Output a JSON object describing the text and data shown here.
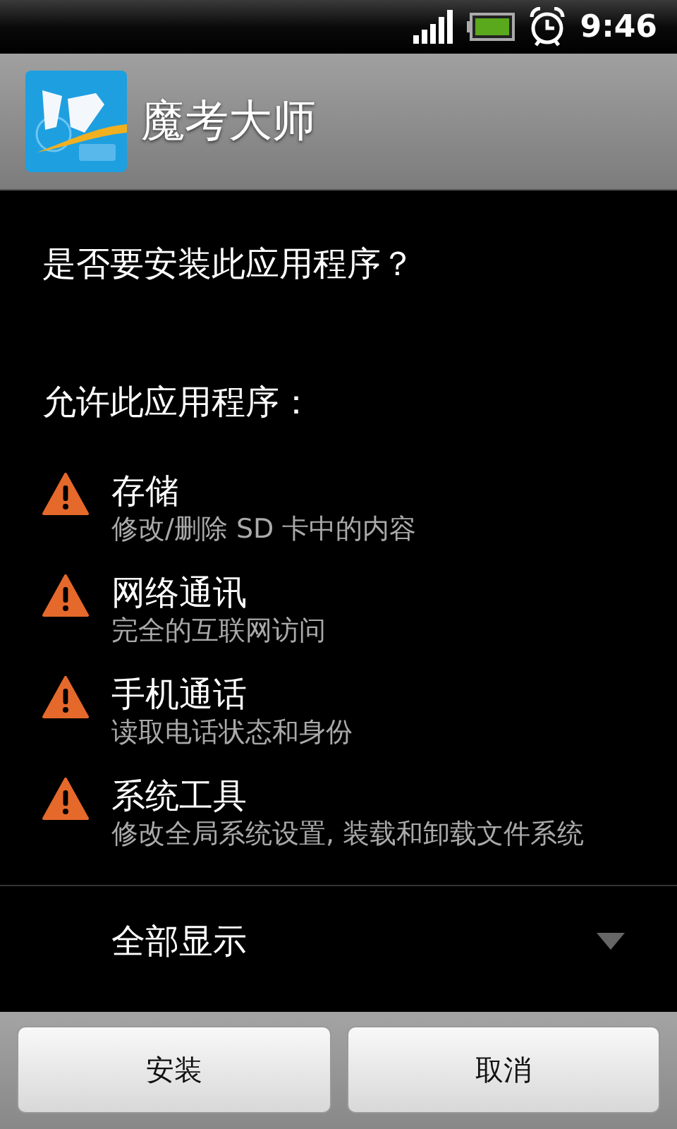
{
  "status_bar": {
    "time": "9:46"
  },
  "header": {
    "title": "魔考大师"
  },
  "question": "是否要安装此应用程序？",
  "permissions_heading": "允许此应用程序：",
  "permissions": [
    {
      "title": "存储",
      "detail": "修改/删除 SD 卡中的内容"
    },
    {
      "title": "网络通讯",
      "detail": "完全的互联网访问"
    },
    {
      "title": "手机通话",
      "detail": "读取电话状态和身份"
    },
    {
      "title": "系统工具",
      "detail": "修改全局系统设置, 装载和卸载文件系统"
    }
  ],
  "show_all": {
    "label": "全部显示",
    "expanded": false
  },
  "buttons": [
    "安装",
    "取消"
  ]
}
